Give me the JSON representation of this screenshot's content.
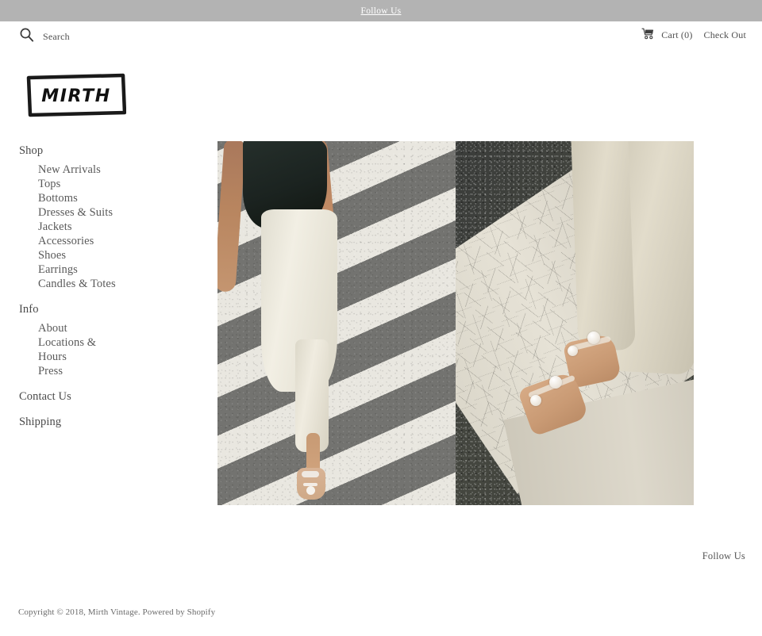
{
  "announcement": {
    "text": "Follow Us"
  },
  "utility": {
    "search": {
      "icon": "search-icon",
      "label": "Search"
    },
    "cart": {
      "icon": "cart-icon",
      "label": "Cart (0)"
    },
    "checkout": {
      "label": "Check Out"
    }
  },
  "logo": {
    "text": "MIRTH",
    "alt": "Mirth Vintage logo"
  },
  "sidebar": {
    "groups": [
      {
        "label": "Shop",
        "items": [
          {
            "label": "New Arrivals"
          },
          {
            "label": "Tops"
          },
          {
            "label": "Bottoms"
          },
          {
            "label": "Dresses & Suits"
          },
          {
            "label": "Jackets"
          },
          {
            "label": "Accessories"
          },
          {
            "label": "Shoes"
          },
          {
            "label": "Earrings"
          },
          {
            "label": "Candles & Totes"
          }
        ]
      },
      {
        "label": "Info",
        "items": [
          {
            "label": "About"
          },
          {
            "label": "Locations &"
          },
          {
            "label": "Hours"
          },
          {
            "label": "Press"
          }
        ]
      }
    ],
    "links": [
      {
        "label": "Contact Us"
      },
      {
        "label": "Shipping"
      }
    ]
  },
  "hero": {
    "left_image_alt": "Model in dark vest and cream trousers walking across a striped crosswalk",
    "right_image_alt": "Close-up of feet in pearl-embellished sandals on cracked white road paint"
  },
  "footer": {
    "social_label": "Follow Us",
    "copyright": "Copyright © 2018, Mirth Vintage. Powered by Shopify"
  },
  "colors": {
    "announcement_bg": "#b3b3b3",
    "announcement_text": "#ffffff",
    "body_text": "#4a4a4a",
    "page_bg": "#ffffff"
  }
}
